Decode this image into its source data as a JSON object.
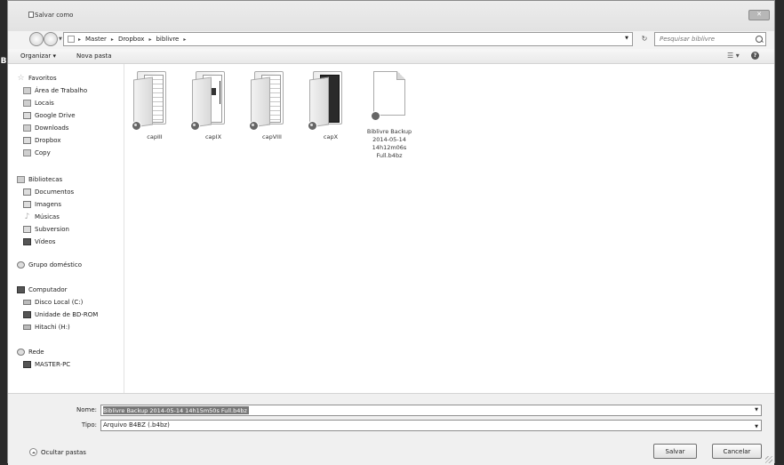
{
  "dialog": {
    "title": "Salvar como",
    "close_label": "✕"
  },
  "address": {
    "crumbs": [
      "Master",
      "Dropbox",
      "biblivre"
    ],
    "separator": "▸",
    "refresh": "↻",
    "search_placeholder": "Pesquisar biblivre"
  },
  "toolbar": {
    "organize_label": "Organizar ▾",
    "new_folder_label": "Nova pasta",
    "view_label": "☰ ▾",
    "help_label": "?"
  },
  "nav": {
    "favorites": {
      "header": "Favoritos",
      "items": [
        "Área de Trabalho",
        "Locais",
        "Google Drive",
        "Downloads",
        "Dropbox",
        "Copy"
      ]
    },
    "libraries": {
      "header": "Bibliotecas",
      "items": [
        "Documentos",
        "Imagens",
        "Músicas",
        "Subversion",
        "Vídeos"
      ]
    },
    "homegroup": {
      "header": "Grupo doméstico"
    },
    "computer": {
      "header": "Computador",
      "items": [
        "Disco Local (C:)",
        "Unidade de BD-ROM",
        "Hitachi (H:)"
      ]
    },
    "network": {
      "header": "Rede",
      "items": [
        "MASTER-PC"
      ]
    }
  },
  "files": [
    {
      "name": "capIII",
      "kind": "folder",
      "icon": "folder-icon"
    },
    {
      "name": "capIX",
      "kind": "folder",
      "icon": "folder-icon"
    },
    {
      "name": "capVIII",
      "kind": "folder",
      "icon": "folder-icon"
    },
    {
      "name": "capX",
      "kind": "folder",
      "icon": "folder-icon"
    },
    {
      "name": "Biblivre Backup 2014-05-14 14h12m06s Full.b4bz",
      "kind": "file",
      "icon": "document-icon"
    }
  ],
  "save": {
    "name_label": "Nome:",
    "name_value": "Biblivre Backup 2014-05-14 14h15m50s Full.b4bz",
    "type_label": "Tipo:",
    "type_value": "Arquivo B4BZ (.b4bz)",
    "hide_folders_label": "Ocultar pastas",
    "save_button": "Salvar",
    "cancel_button": "Cancelar"
  },
  "colors": {
    "window_bg": "#f3f3f3",
    "pane_bg": "#ffffff",
    "selection": "#777777"
  }
}
